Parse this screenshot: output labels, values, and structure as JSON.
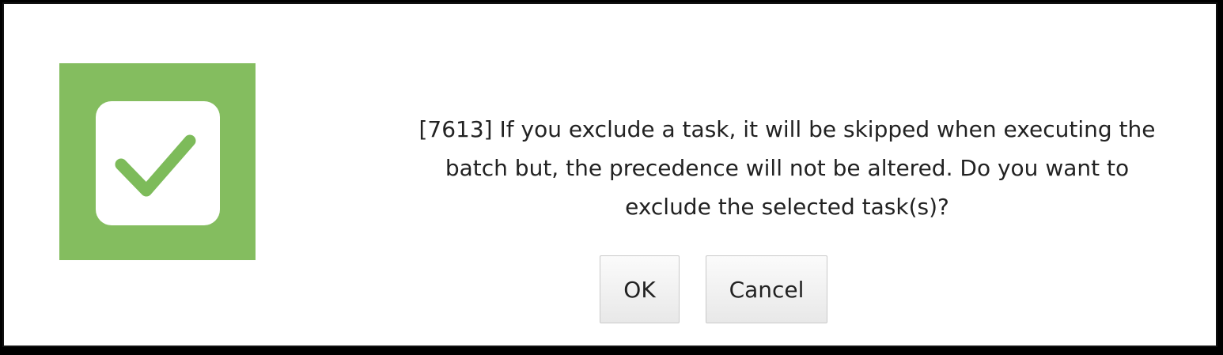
{
  "dialog": {
    "icon": "check-icon",
    "message_lines": [
      "[7613] If you exclude a task, it will be skipped when executing the",
      "batch but, the precedence will not be altered. Do you want to",
      "exclude the selected task(s)?"
    ],
    "ok_label": "OK",
    "cancel_label": "Cancel"
  },
  "colors": {
    "icon_background": "#84bd5f",
    "icon_tile": "#ffffff",
    "check_mark": "#7dbb5a"
  }
}
